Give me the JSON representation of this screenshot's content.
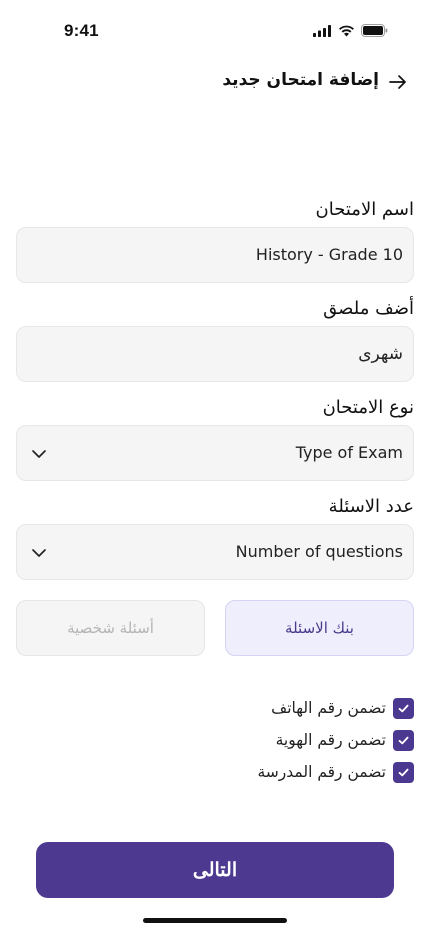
{
  "status_bar": {
    "time": "9:41"
  },
  "header": {
    "title": "إضافة امتحان جديد"
  },
  "form": {
    "exam_name": {
      "label": "اسم الامتحان",
      "value": "History - Grade 10"
    },
    "sticker": {
      "label": "أضف ملصق",
      "value": "شهرى"
    },
    "exam_type": {
      "label": "نوع الامتحان",
      "value": "Type of Exam"
    },
    "question_count": {
      "label": "عدد الاسئلة",
      "value": "Number of questions"
    }
  },
  "question_source": {
    "bank": "بنك الاسئلة",
    "personal": "أسئلة شخصية",
    "selected": "bank"
  },
  "options": [
    {
      "label": "تضمن رقم الهاتف",
      "checked": true
    },
    {
      "label": "تضمن رقم الهوية",
      "checked": true
    },
    {
      "label": "تضمن رقم المدرسة",
      "checked": true
    }
  ],
  "actions": {
    "next": "التالى"
  },
  "colors": {
    "primary": "#4e3990",
    "selected_bg": "#efeefd",
    "field_bg": "#f5f5f5"
  }
}
